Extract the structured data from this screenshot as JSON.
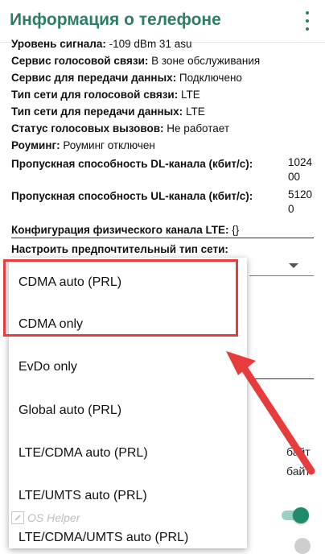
{
  "appbar": {
    "title": "Информация о телефоне",
    "menu_icon": "more-vert-icon"
  },
  "info": {
    "signal_label": "Уровень сигнала:",
    "signal_value": "-109 dBm   31 asu",
    "voice_service_label": "Сервис голосовой связи:",
    "voice_service_value": "В зоне обслуживания",
    "data_service_label": "Сервис для передачи данных:",
    "data_service_value": "Подключено",
    "voice_net_label": "Тип сети для голосовой связи:",
    "voice_net_value": "LTE",
    "data_net_label": "Тип сети для передачи данных:",
    "data_net_value": "LTE",
    "voice_calls_label": "Статус голосовых вызовов:",
    "voice_calls_value": "Не работает",
    "roaming_label": "Роуминг:",
    "roaming_value": "Роуминг отключен",
    "dl_label": "Пропускная способность DL-канала (кбит/с):",
    "dl_value": "102400",
    "ul_label": "Пропускная способность UL-канала (кбит/с):",
    "ul_value": "51200",
    "lte_config_label": "Конфигурация физического канала LTE:",
    "lte_config_value": "{}",
    "pref_label": "Настроить предпочтительный тип сети:"
  },
  "background": {
    "text1": "байт",
    "text2": "байт"
  },
  "dropdown": {
    "options": [
      "CDMA auto (PRL)",
      "CDMA only",
      "EvDo only",
      "Global auto (PRL)",
      "LTE/CDMA auto (PRL)",
      "LTE/UMTS auto (PRL)",
      "LTE/CDMA/UMTS auto (PRL)"
    ]
  },
  "watermark": {
    "text": "OS Helper"
  },
  "colors": {
    "accent": "#2e7d6b",
    "highlight": "#e63c3c",
    "toggle_on": "#1f8a6c"
  }
}
